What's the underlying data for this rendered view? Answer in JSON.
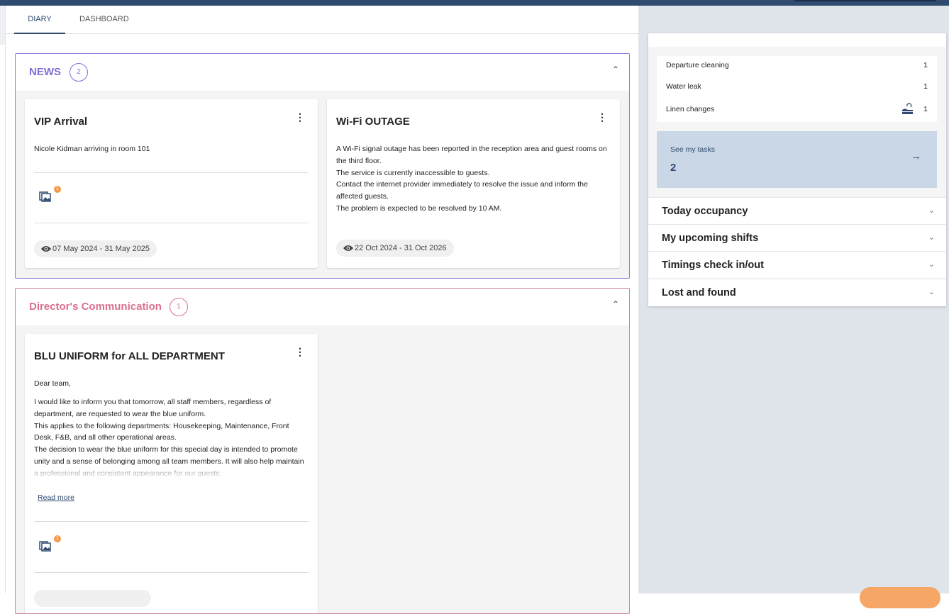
{
  "tabs": [
    {
      "label": "DIARY",
      "active": true
    },
    {
      "label": "DASHBOARD",
      "active": false
    }
  ],
  "news": {
    "title": "NEWS",
    "count": "2",
    "color": "#7a6fd8",
    "cards": [
      {
        "title": "VIP Arrival",
        "body": [
          "Nicole Kidman arriving in room 101"
        ],
        "attachments": "1",
        "dates": "07 May 2024 - 31 May 2025"
      },
      {
        "title": "Wi-Fi OUTAGE",
        "body": [
          "A Wi-Fi signal outage has been reported in the reception area and guest rooms on the third floor.",
          "The service is currently inaccessible to guests.",
          "Contact the internet provider immediately to resolve the issue and inform the affected guests.",
          "The problem is expected to be resolved by 10 AM."
        ],
        "dates": "22 Oct 2024 - 31 Oct 2026"
      }
    ]
  },
  "director": {
    "title": "Director's Communication",
    "count": "1",
    "color": "#d9708f",
    "cards": [
      {
        "title": "BLU UNIFORM for ALL DEPARTMENT",
        "greeting": "Dear team,",
        "body": [
          "I would like to inform you that tomorrow, all staff members, regardless of department, are requested to wear the blue uniform.",
          "This applies to the following departments: Housekeeping, Maintenance, Front Desk, F&B, and all other operational areas.",
          "The decision to wear the blue uniform for this special day is intended to promote unity and a sense of belonging among all team members. It will also help maintain a professional and consistent appearance for our guests."
        ],
        "read_more": "Read more",
        "attachments": "1"
      }
    ]
  },
  "tasks_list": [
    {
      "label": "Departure cleaning",
      "count": "1"
    },
    {
      "label": "Water leak",
      "count": "1"
    },
    {
      "label": "Linen changes",
      "count": "1",
      "icon": "linen-change-icon"
    }
  ],
  "see_tasks": {
    "label": "See my tasks",
    "count": "2"
  },
  "accordions": [
    {
      "label": "Today occupancy"
    },
    {
      "label": "My upcoming shifts"
    },
    {
      "label": "Timings check in/out"
    },
    {
      "label": "Lost and found"
    }
  ]
}
